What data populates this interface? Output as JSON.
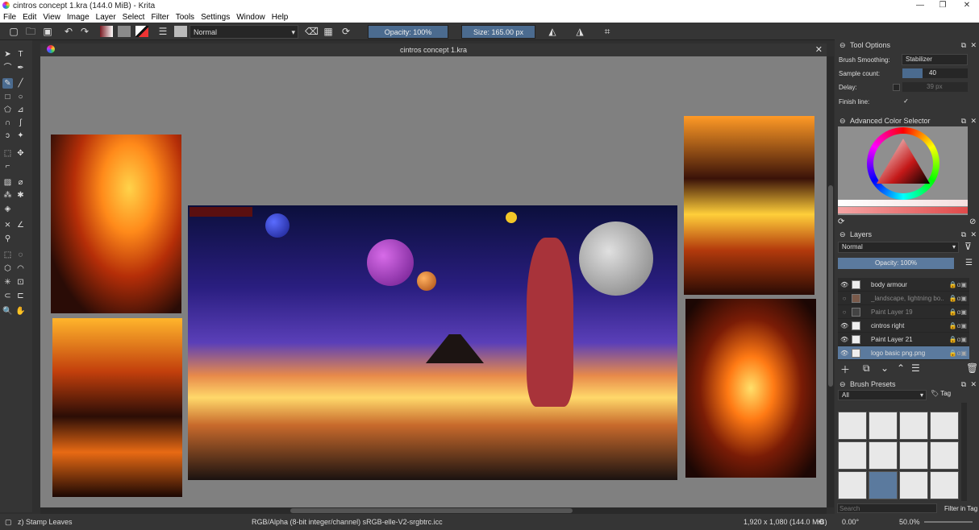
{
  "window": {
    "title": "cintros concept 1.kra (144.0 MiB)  - Krita",
    "minimize": "—",
    "restore": "❐",
    "close": "✕"
  },
  "menu": [
    "File",
    "Edit",
    "View",
    "Image",
    "Layer",
    "Select",
    "Filter",
    "Tools",
    "Settings",
    "Window",
    "Help"
  ],
  "toolbar": {
    "blend_mode": "Normal",
    "opacity": "Opacity: 100%",
    "size": "Size: 165.00 px"
  },
  "document": {
    "tab_title": "cintros concept 1.kra",
    "close": "✕"
  },
  "status": {
    "brush": "z) Stamp Leaves",
    "color_info": "RGB/Alpha (8-bit integer/channel)  sRGB-elle-V2-srgbtrc.icc",
    "dimensions": "1,920 x 1,080 (144.0 MiB)",
    "rotation": "0.00°",
    "zoom": "50.0%"
  },
  "tool_options": {
    "title": "Tool Options",
    "smoothing_label": "Brush Smoothing:",
    "smoothing_value": "Stabilizer",
    "sample_label": "Sample count:",
    "sample_value": "40",
    "delay_label": "Delay:",
    "delay_value": "39 px",
    "finish_label": "Finish line:",
    "finish_check": "✓"
  },
  "color_selector": {
    "title": "Advanced Color Selector"
  },
  "layers": {
    "title": "Layers",
    "blend": "Normal",
    "opacity": "Opacity:  100%",
    "items": [
      {
        "name": "body armour",
        "visible": true
      },
      {
        "name": "_landscape, lightning bo...",
        "visible": false
      },
      {
        "name": "Paint Layer 19",
        "visible": false
      },
      {
        "name": "cintros right",
        "visible": true
      },
      {
        "name": "Paint Layer 21",
        "visible": true
      },
      {
        "name": "logo basic png.png",
        "visible": true,
        "selected": true
      }
    ]
  },
  "brush_presets": {
    "title": "Brush Presets",
    "filter": "All",
    "tag": "Tag",
    "search_placeholder": "Search",
    "filter_in_tag": "Filter in Tag"
  },
  "colors": {
    "accent": "#4b6b8f",
    "panel": "#353535",
    "canvas_bg": "#808080"
  }
}
